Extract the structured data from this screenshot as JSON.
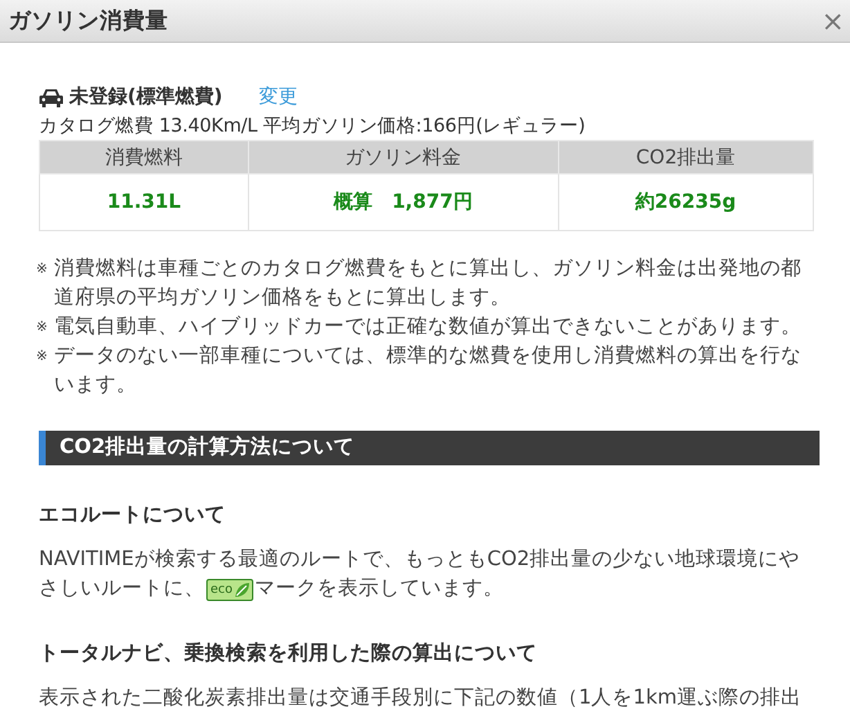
{
  "window": {
    "title": "ガソリン消費量",
    "close": "×"
  },
  "vehicle": {
    "name": "未登録(標準燃費)",
    "change_link": "変更",
    "catalog": "カタログ燃費 13.40Km/L 平均ガソリン価格:166円(レギュラー)"
  },
  "table": {
    "columns": [
      "消費燃料",
      "ガソリン料金",
      "CO2排出量"
    ],
    "rows": [
      [
        "11.31L",
        "概算　1,877円",
        "約26235g"
      ]
    ]
  },
  "notes": [
    {
      "mark": "※",
      "text": "消費燃料は車種ごとのカタログ燃費をもとに算出し、ガソリン料金は出発地の都道府県の平均ガソリン価格をもとに算出します。"
    },
    {
      "mark": "※",
      "text": "電気自動車、ハイブリッドカーでは正確な数値が算出できないことがあります。"
    },
    {
      "mark": "※",
      "text": "データのない一部車種については、標準的な燃費を使用し消費燃料の算出を行ないます。"
    }
  ],
  "section": {
    "title": "CO2排出量の計算方法について",
    "subsections": [
      {
        "heading": "エコルートについて",
        "text_before": "NAVITIMEが検索する最適のルートで、もっともCO2排出量の少ない地球環境にやさしいルートに、",
        "badge": "eco",
        "text_after": "マークを表示しています。"
      },
      {
        "heading": "トータルナビ、乗換検索を利用した際の算出について",
        "text_before": "表示された二酸化炭素排出量は交通手段別に下記の数値（1人を1km運ぶ際の排出"
      }
    ]
  }
}
